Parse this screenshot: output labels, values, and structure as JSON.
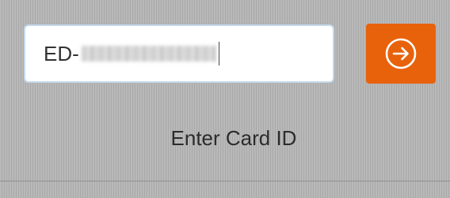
{
  "card_form": {
    "input_value": "ED-",
    "submit_icon": "arrow-right-circle-icon",
    "accent_color": "#e8620b"
  },
  "status": {
    "prompt": "Enter Card ID"
  }
}
